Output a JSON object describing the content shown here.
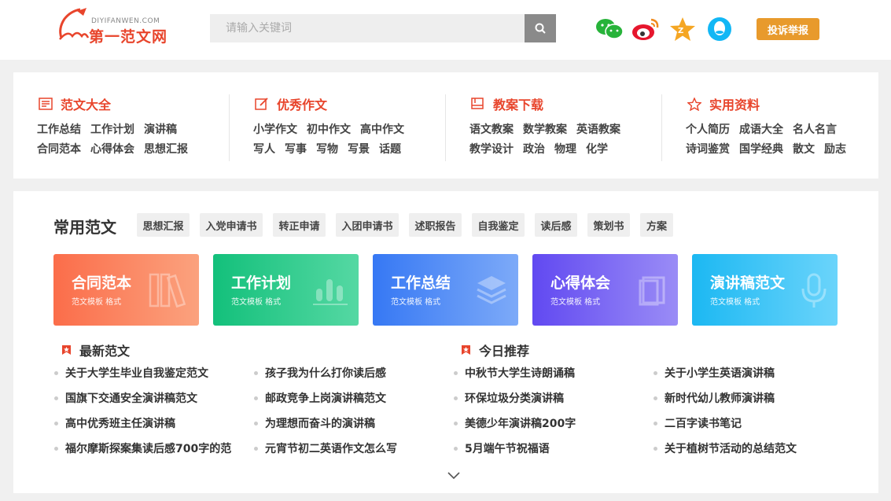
{
  "logo": {
    "en": "DIYIFANWEN.COM",
    "cn": "第一范文网"
  },
  "search": {
    "placeholder": "请输入关键词"
  },
  "social": [
    "wechat-icon",
    "weibo-icon",
    "qzone-icon",
    "qq-icon"
  ],
  "report_label": "投诉举报",
  "categories": [
    {
      "title": "范文大全",
      "rows": [
        [
          "工作总结",
          "工作计划",
          "演讲稿"
        ],
        [
          "合同范本",
          "心得体会",
          "思想汇报"
        ]
      ]
    },
    {
      "title": "优秀作文",
      "rows": [
        [
          "小学作文",
          "初中作文",
          "高中作文"
        ],
        [
          "写人",
          "写事",
          "写物",
          "写景",
          "话题"
        ]
      ]
    },
    {
      "title": "教案下载",
      "rows": [
        [
          "语文教案",
          "数学教案",
          "英语教案"
        ],
        [
          "教学设计",
          "政治",
          "物理",
          "化学"
        ]
      ]
    },
    {
      "title": "实用资料",
      "rows": [
        [
          "个人简历",
          "成语大全",
          "名人名言"
        ],
        [
          "诗词鉴赏",
          "国学经典",
          "散文",
          "励志"
        ]
      ]
    }
  ],
  "common": {
    "title": "常用范文",
    "tags": [
      "思想汇报",
      "入党申请书",
      "转正申请",
      "入团申请书",
      "述职报告",
      "自我鉴定",
      "读后感",
      "策划书",
      "方案"
    ]
  },
  "cards": [
    {
      "title": "合同范本",
      "sub": "范文模板 格式"
    },
    {
      "title": "工作计划",
      "sub": "范文模板 格式"
    },
    {
      "title": "工作总结",
      "sub": "范文模板 格式"
    },
    {
      "title": "心得体会",
      "sub": "范文模板 格式"
    },
    {
      "title": "演讲稿范文",
      "sub": "范文模板 格式"
    }
  ],
  "latest": {
    "title": "最新范文",
    "items": [
      "关于大学生毕业自我鉴定范文",
      "孩子我为什么打你读后感",
      "国旗下交通安全演讲稿范文",
      "邮政竞争上岗演讲稿范文",
      "高中优秀班主任演讲稿",
      "为理想而奋斗的演讲稿",
      "福尔摩斯探案集读后感700字的范",
      "元宵节初二英语作文怎么写"
    ]
  },
  "today": {
    "title": "今日推荐",
    "items": [
      "中秋节大学生诗朗诵稿",
      "关于小学生英语演讲稿",
      "环保垃圾分类演讲稿",
      "新时代幼儿教师演讲稿",
      "美德少年演讲稿200字",
      "二百字读书笔记",
      "5月端午节祝福语",
      "关于植树节活动的总结范文"
    ]
  },
  "colors": {
    "accent": "#e8452c",
    "report": "#e89a2c"
  }
}
